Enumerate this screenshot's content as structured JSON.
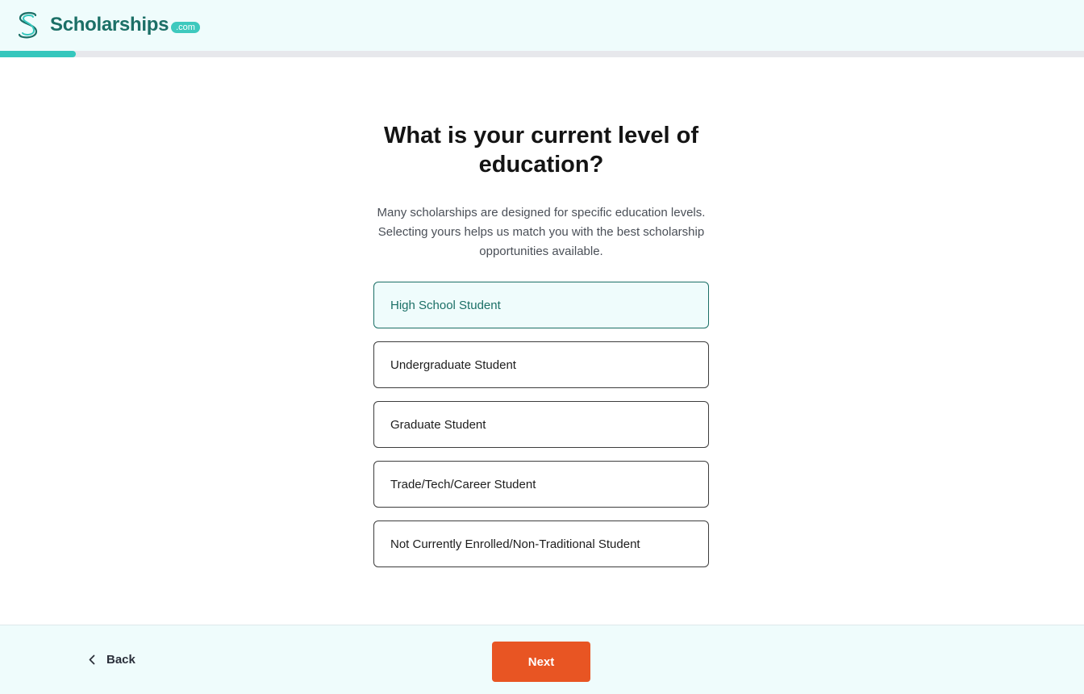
{
  "brand": {
    "name": "Scholarships",
    "tld": ".com",
    "logo_icon": "s-logo-icon",
    "primary_color": "#1b6f66",
    "accent_color": "#35c7bd",
    "cta_color": "#e85523"
  },
  "progress": {
    "fraction": 0.07
  },
  "question": {
    "title": "What is your current level of education?",
    "subtitle": "Many scholarships are designed for specific education levels. Selecting yours helps us match you with the best scholarship opportunities available."
  },
  "options": [
    {
      "label": "High School Student",
      "selected": true
    },
    {
      "label": "Undergraduate Student",
      "selected": false
    },
    {
      "label": "Graduate Student",
      "selected": false
    },
    {
      "label": "Trade/Tech/Career Student",
      "selected": false
    },
    {
      "label": "Not Currently Enrolled/Non-Traditional Student",
      "selected": false
    }
  ],
  "footer": {
    "back_label": "Back",
    "back_icon": "chevron-left-icon",
    "next_label": "Next"
  }
}
